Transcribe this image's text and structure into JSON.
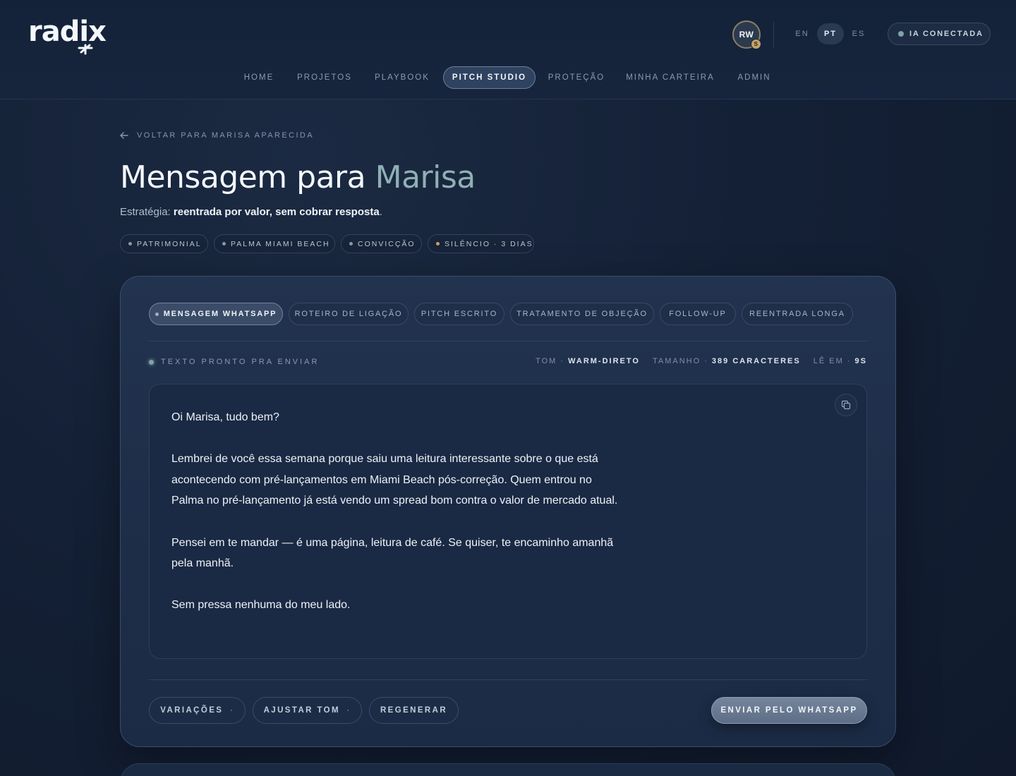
{
  "app": {
    "logo": "radix"
  },
  "header": {
    "avatar_initials": "RW",
    "avatar_badge": "S",
    "languages": [
      {
        "label": "EN",
        "active": false
      },
      {
        "label": "PT",
        "active": true
      },
      {
        "label": "ES",
        "active": false
      }
    ],
    "ia_status": "IA CONECTADA",
    "ia_status_color": "#7fa3a6"
  },
  "nav": {
    "items": [
      {
        "label": "HOME",
        "active": false
      },
      {
        "label": "PROJETOS",
        "active": false
      },
      {
        "label": "PLAYBOOK",
        "active": false
      },
      {
        "label": "PITCH STUDIO",
        "active": true
      },
      {
        "label": "PROTEÇÃO",
        "active": false
      },
      {
        "label": "MINHA CARTEIRA",
        "active": false
      },
      {
        "label": "ADMIN",
        "active": false
      }
    ]
  },
  "page": {
    "back_label": "VOLTAR PARA MARISA APARECIDA",
    "title_prefix": "Mensagem para",
    "title_name": "Marisa",
    "strategy_label": "Estratégia:",
    "strategy_value": "reentrada por valor, sem cobrar resposta",
    "strategy_end": ".",
    "tags": [
      {
        "label": "PATRIMONIAL",
        "dot": "#8b97a8"
      },
      {
        "label": "PALMA MIAMI BEACH",
        "dot": "#8b97a8"
      },
      {
        "label": "CONVICÇÃO",
        "dot": "#8b97a8"
      },
      {
        "label": "SILÊNCIO · 3 DIAS",
        "dot": "#c9a35c"
      }
    ]
  },
  "card": {
    "tabs": [
      {
        "label": "MENSAGEM WHATSAPP",
        "active": true
      },
      {
        "label": "ROTEIRO DE LIGAÇÃO",
        "active": false
      },
      {
        "label": "PITCH ESCRITO",
        "active": false
      },
      {
        "label": "TRATAMENTO DE OBJEÇÃO",
        "active": false
      },
      {
        "label": "FOLLOW-UP",
        "active": false
      },
      {
        "label": "REENTRADA LONGA",
        "active": false
      }
    ],
    "ready_label": "TEXTO PRONTO PRA ENVIAR",
    "meta": {
      "tone_label": "TOM ·",
      "tone_value": "WARM-DIRETO",
      "size_label": "TAMANHO ·",
      "size_value": "389 CARACTERES",
      "read_label": "LÊ EM ·",
      "read_value": "9S"
    },
    "message": [
      "Oi Marisa, tudo bem?",
      "Lembrei de você essa semana porque saiu uma leitura interessante sobre o que está acontecendo com pré-lançamentos em Miami Beach pós-correção. Quem entrou no Palma no pré-lançamento já está vendo um spread bom contra o valor de mercado atual.",
      "Pensei em te mandar — é uma página, leitura de café. Se quiser, te encaminho amanhã pela manhã.",
      "Sem pressa nenhuma do meu lado."
    ],
    "actions": {
      "variations": "VARIAÇÕES",
      "adjust_tone": "AJUSTAR TOM",
      "regenerate": "REGENERAR",
      "send": "ENVIAR PELO WHATSAPP"
    }
  }
}
